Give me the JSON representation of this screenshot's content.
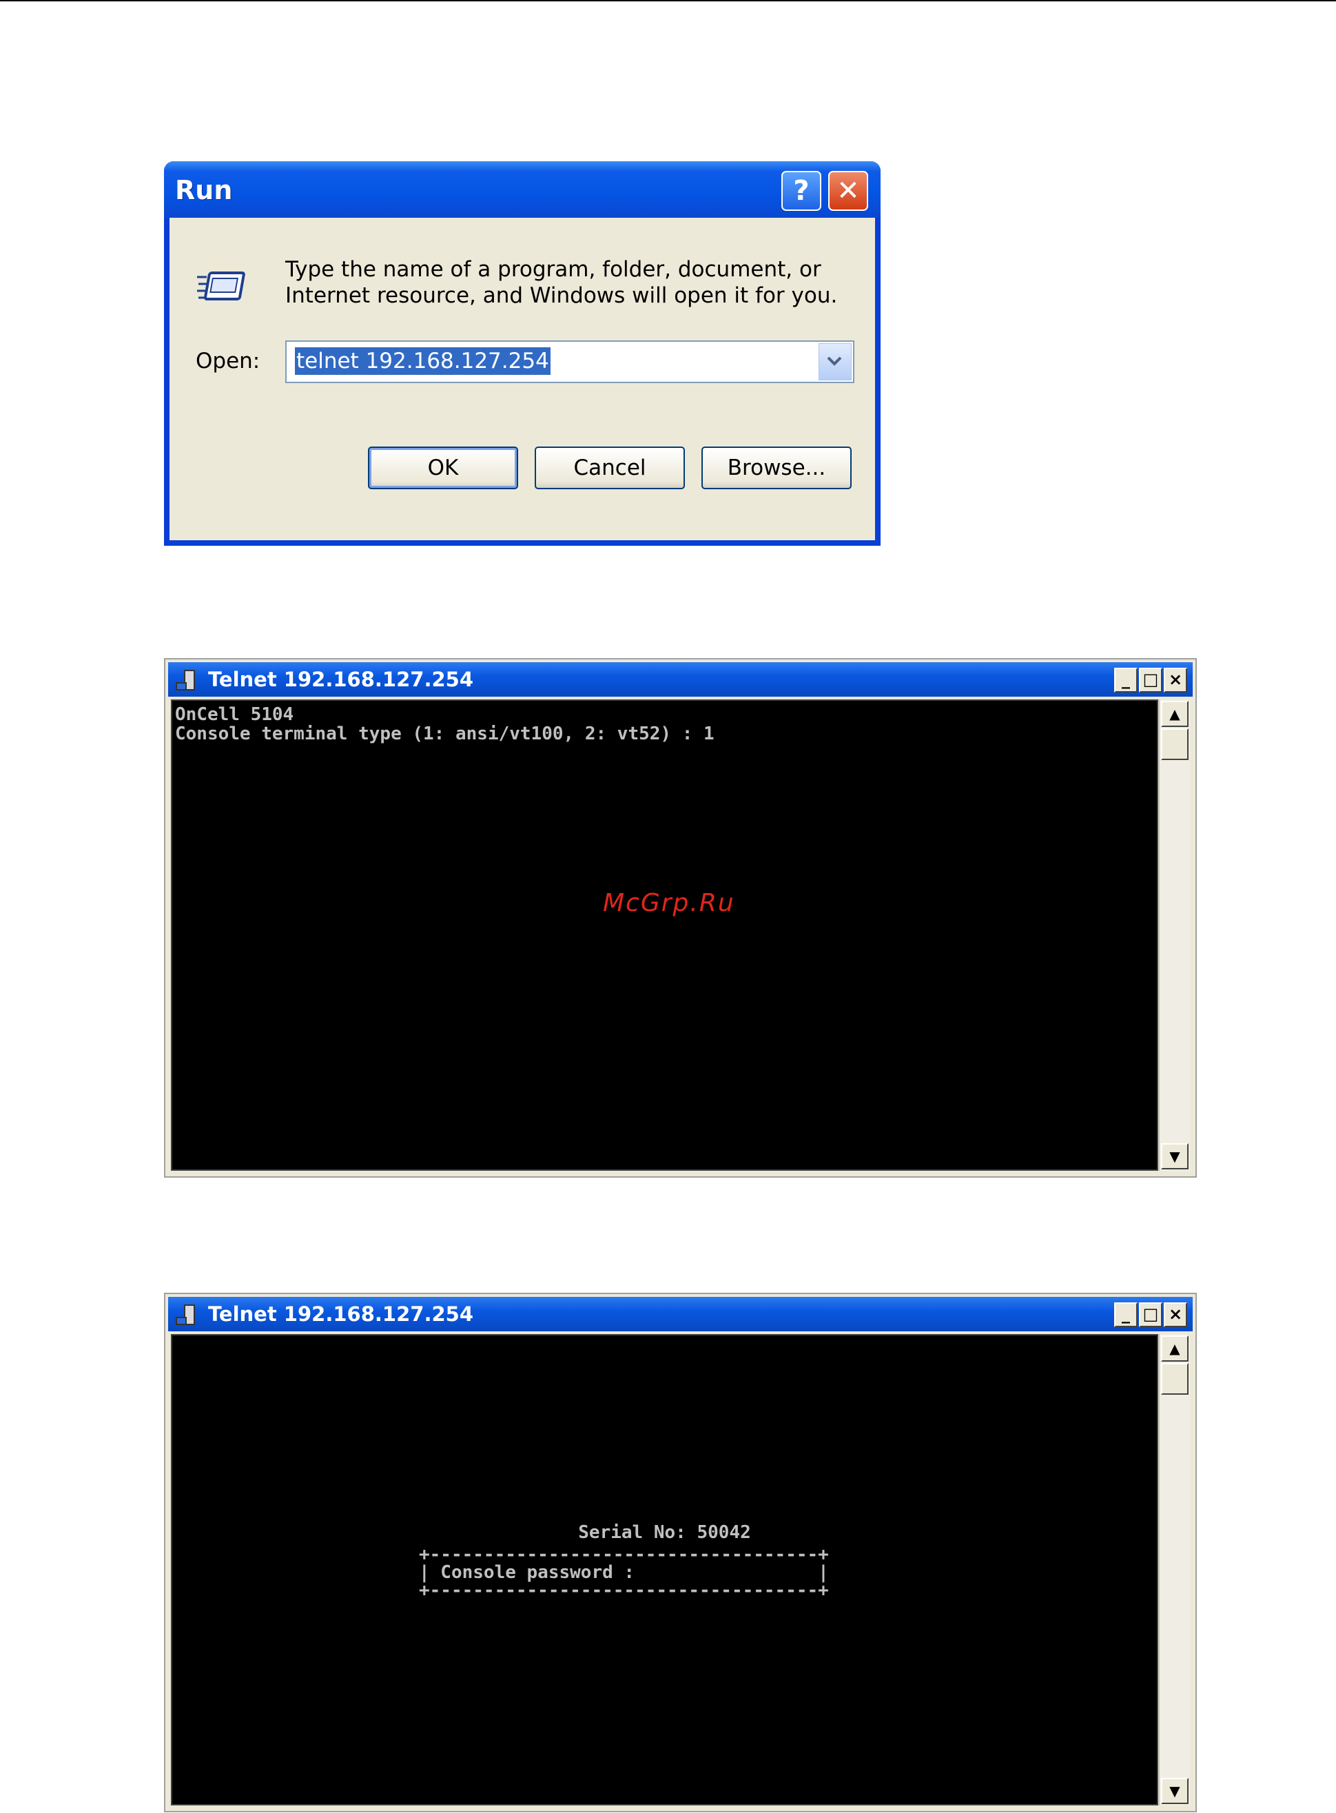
{
  "run_dialog": {
    "title": "Run",
    "help_glyph": "?",
    "close_glyph": "✕",
    "description_line1": "Type the name of a program, folder, document, or",
    "description_line2": "Internet resource, and Windows will open it for you.",
    "open_label": "Open:",
    "open_value": "telnet 192.168.127.254",
    "ok_label": "OK",
    "cancel_label": "Cancel",
    "browse_label": "Browse...",
    "icon": "run-program-icon"
  },
  "telnet_window_1": {
    "title": "Telnet 192.168.127.254",
    "minimize_glyph": "_",
    "maximize_glyph": "□",
    "close_glyph": "×",
    "console_text": "OnCell 5104\nConsole terminal type (1: ansi/vt100, 2: vt52) : 1"
  },
  "telnet_window_2": {
    "title": "Telnet 192.168.127.254",
    "minimize_glyph": "_",
    "maximize_glyph": "□",
    "close_glyph": "×",
    "serial_line": "Serial No: 50042",
    "box_top": "+------------------------------------+",
    "box_middle": "| Console password :                 |",
    "box_bottom": "+------------------------------------+"
  },
  "watermark": "McGrp.Ru",
  "colors": {
    "xp_title_blue": "#0554e3",
    "dialog_face": "#ece9d8",
    "console_bg": "#000000",
    "console_fg": "#c0c0c0",
    "watermark_red": "#e0261c"
  }
}
